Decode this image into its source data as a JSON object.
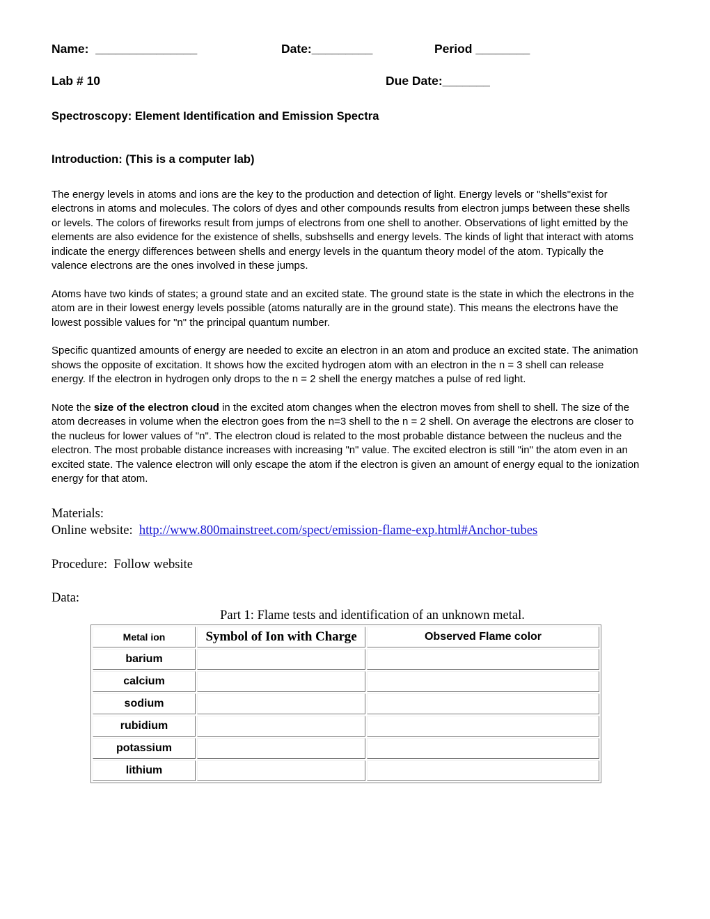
{
  "header": {
    "name_label": "Name:  _______________",
    "date_label": "Date:_________",
    "period_label": "Period ________",
    "lab_label": "Lab # 10",
    "due_date_label": "Due Date:_______"
  },
  "title": "Spectroscopy: Element Identification and Emission Spectra",
  "introduction": {
    "heading": "Introduction: (This is a computer lab)",
    "paragraph_1": "The energy levels in atoms and ions are the key to the production and detection of light. Energy levels or \"shells\"exist for electrons in atoms and molecules. The colors of dyes and other compounds results from electron jumps between these shells or levels. The colors of fireworks result from jumps of electrons from one shell to another. Observations of light emitted by the elements are also evidence for the existence of shells, subshsells and energy levels. The kinds of light that interact with atoms indicate the energy differences between shells and energy levels in the quantum theory model of the atom. Typically the valence electrons are the ones involved in these jumps.",
    "paragraph_2": "Atoms have two kinds of states; a ground state and an excited state. The ground state is the state in which the electrons in the atom are in their lowest energy levels possible (atoms naturally are in the ground state). This means the electrons have the lowest possible values for \"n\" the principal quantum number.",
    "paragraph_3": "Specific quantized amounts of energy are needed to excite an electron in an atom and produce an excited state. The animation shows the opposite of excitation. It shows how the excited hydrogen atom with an electron in the n = 3 shell can release energy. If the electron in hydrogen only drops to the n = 2 shell the energy matches a pulse of red light.",
    "paragraph_4_part_1": "Note the ",
    "paragraph_4_bold": "size of the electron cloud",
    "paragraph_4_part_2": " in the excited atom changes when the electron moves from shell to shell. The size of the atom decreases in volume when the electron goes from the n=3 shell to the n = 2 shell. On average the electrons are closer to the nucleus for lower values of \"n\". The electron cloud is related to the most probable distance between the nucleus and the electron. The most probable distance increases with increasing \"n\" value. The excited electron is still \"in\" the atom even in an excited state. The valence electron will only escape the atom if the electron is given an amount of energy equal to the ionization energy for that atom."
  },
  "materials": {
    "label": "Materials:",
    "website_label": "Online website:  ",
    "website_url": "http://www.800mainstreet.com/spect/emission-flame-exp.html#Anchor-tubes",
    "link_color": "#1414d2"
  },
  "procedure": {
    "label": "Procedure:  Follow website"
  },
  "data_section": {
    "label": "Data:",
    "part_caption": "Part 1:  Flame tests and identification of an unknown metal."
  },
  "table": {
    "headers": [
      "Metal ion",
      "Symbol of Ion with Charge",
      "Observed Flame color"
    ],
    "rows": [
      {
        "metal": "barium",
        "symbol": "",
        "flame": ""
      },
      {
        "metal": "calcium",
        "symbol": "",
        "flame": ""
      },
      {
        "metal": "sodium",
        "symbol": "",
        "flame": ""
      },
      {
        "metal": "rubidium",
        "symbol": "",
        "flame": ""
      },
      {
        "metal": "potassium",
        "symbol": "",
        "flame": ""
      },
      {
        "metal": "lithium",
        "symbol": "",
        "flame": ""
      }
    ]
  }
}
